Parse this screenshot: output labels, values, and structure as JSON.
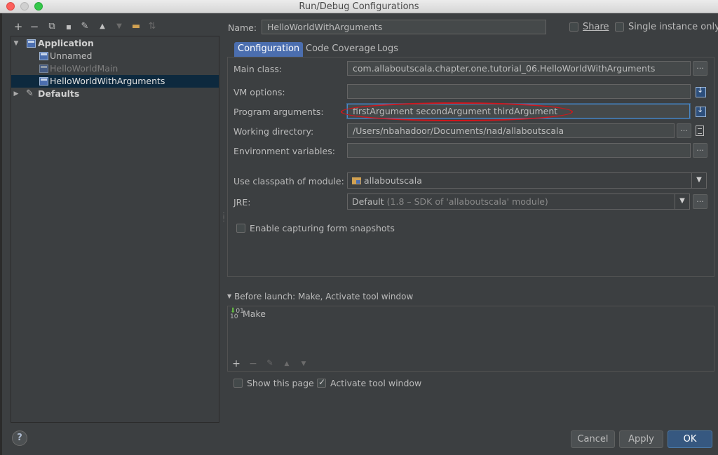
{
  "window": {
    "title": "Run/Debug Configurations"
  },
  "toolbar": {
    "icons": [
      "add-icon",
      "remove-icon",
      "copy-icon",
      "save-icon",
      "wrench-icon",
      "move-up-icon",
      "move-down-icon",
      "folder-icon",
      "sort-icon"
    ]
  },
  "tree": {
    "items": [
      {
        "label": "Application",
        "level": 0,
        "expanded": true
      },
      {
        "label": "Unnamed",
        "level": 1
      },
      {
        "label": "HelloWorldMain",
        "level": 1
      },
      {
        "label": "HelloWorldWithArguments",
        "level": 1,
        "selected": true
      },
      {
        "label": "Defaults",
        "level": 0,
        "expanded": false
      }
    ]
  },
  "header": {
    "name_label": "Name:",
    "name_value": "HelloWorldWithArguments",
    "share_label": "Share",
    "single_instance_label": "Single instance only"
  },
  "tabs": [
    {
      "label": "Configuration",
      "active": true
    },
    {
      "label": "Code Coverage"
    },
    {
      "label": "Logs"
    }
  ],
  "config": {
    "main_class_label": "Main class:",
    "main_class_value": "com.allaboutscala.chapter.one.tutorial_06.HelloWorldWithArguments",
    "vm_options_label": "VM options:",
    "vm_options_value": "",
    "program_args_label": "Program arguments:",
    "program_args_value": "firstArgument secondArgument thirdArgument",
    "working_dir_label": "Working directory:",
    "working_dir_value": "/Users/nbahadoor/Documents/nad/allaboutscala",
    "env_vars_label": "Environment variables:",
    "env_vars_value": "",
    "classpath_label": "Use classpath of module:",
    "classpath_value": "allaboutscala",
    "jre_label": "JRE:",
    "jre_value": "Default",
    "jre_detail": "(1.8 – SDK of 'allaboutscala' module)",
    "snapshots_label": "Enable capturing form snapshots",
    "dots": "..."
  },
  "before_launch": {
    "header": "Before launch: Make, Activate tool window",
    "items": [
      "Make"
    ],
    "show_page_label": "Show this page",
    "activate_label": "Activate tool window"
  },
  "buttons": {
    "help": "?",
    "cancel": "Cancel",
    "apply": "Apply",
    "ok": "OK"
  },
  "colors": {
    "accent": "#4b6eaf",
    "selection": "#0d293e",
    "annotation": "#d0161b",
    "ok_button": "#365880"
  }
}
